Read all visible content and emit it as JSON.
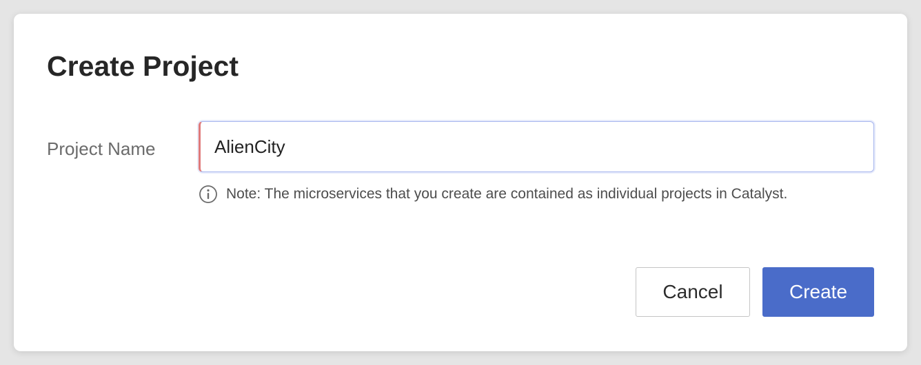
{
  "dialog": {
    "title": "Create Project"
  },
  "form": {
    "project_name_label": "Project Name",
    "project_name_value": "AlienCity",
    "note_icon": "info-icon",
    "note_text": "Note: The microservices that you create are contained as individual projects in Catalyst."
  },
  "actions": {
    "cancel_label": "Cancel",
    "create_label": "Create"
  },
  "colors": {
    "primary": "#4a6cc9",
    "input_focus_border": "#a7b6ee",
    "required_indicator": "#e07a7a"
  }
}
